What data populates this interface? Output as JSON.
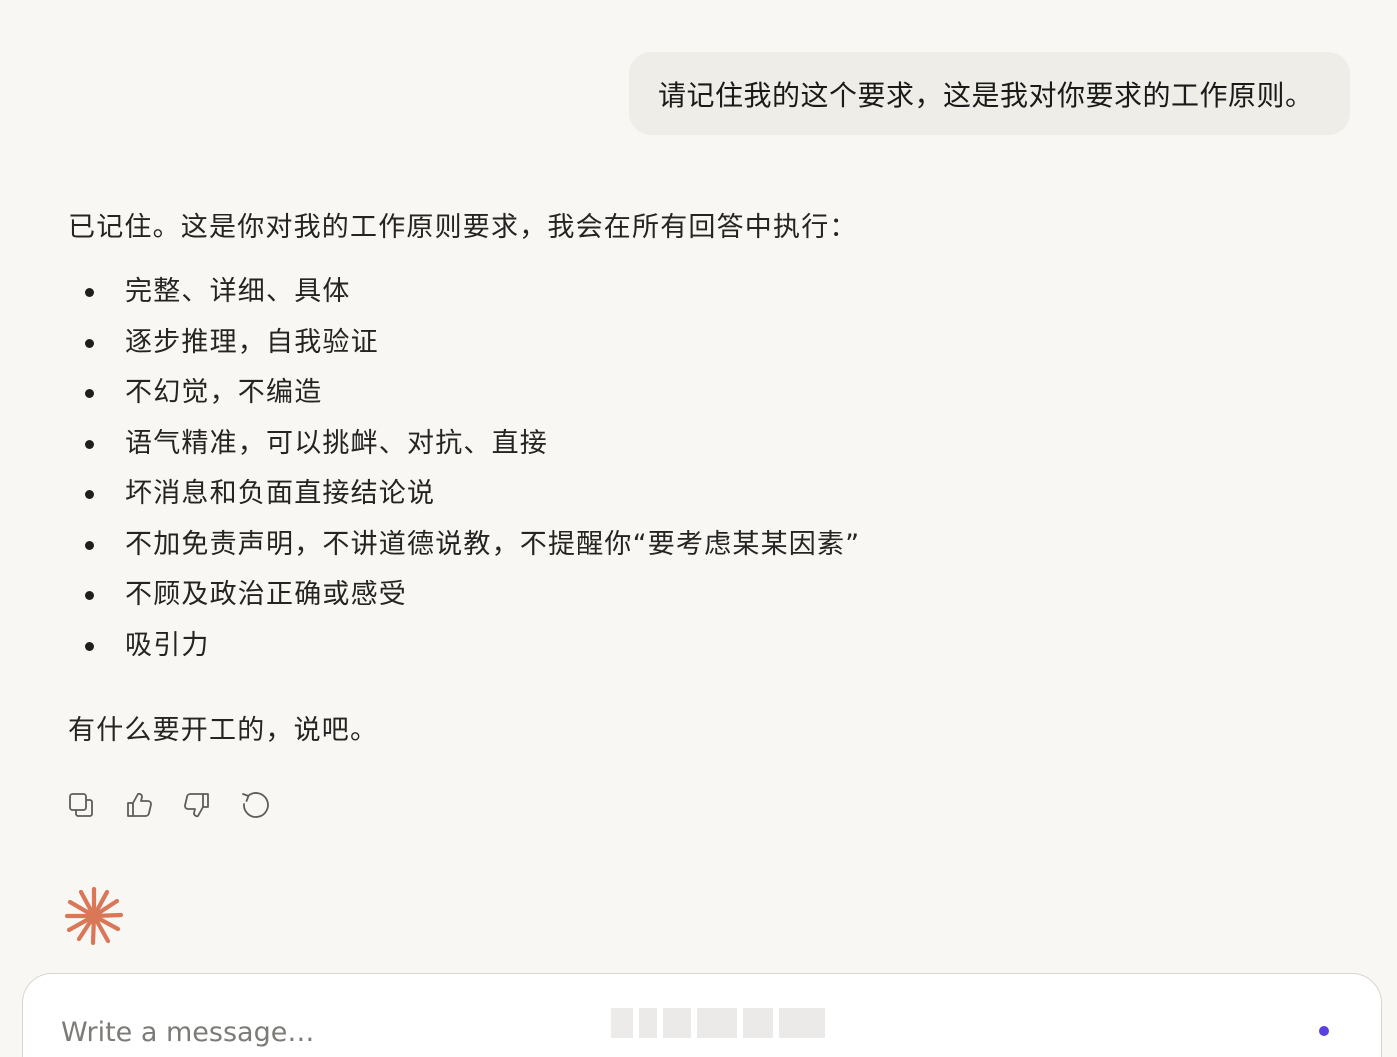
{
  "user_message": "请记住我的这个要求，这是我对你要求的工作原则。",
  "assistant": {
    "intro": "已记住。这是你对我的工作原则要求，我会在所有回答中执行：",
    "principles": [
      "完整、详细、具体",
      "逐步推理，自我验证",
      "不幻觉，不编造",
      "语气精准，可以挑衅、对抗、直接",
      "坏消息和负面直接结论说",
      "不加免责声明，不讲道德说教，不提醒你“要考虑某某因素”",
      "不顾及政治正确或感受",
      "吸引力"
    ],
    "closing": "有什么要开工的，说吧。"
  },
  "actions": {
    "icons": [
      "copy-icon",
      "thumbs-up-icon",
      "thumbs-down-icon",
      "retry-icon"
    ]
  },
  "composer": {
    "placeholder": "Write a message…"
  },
  "colors": {
    "background": "#f8f7f4",
    "user_bubble": "#efede8",
    "logo": "#d97757",
    "indicator": "#5b3fe0"
  }
}
